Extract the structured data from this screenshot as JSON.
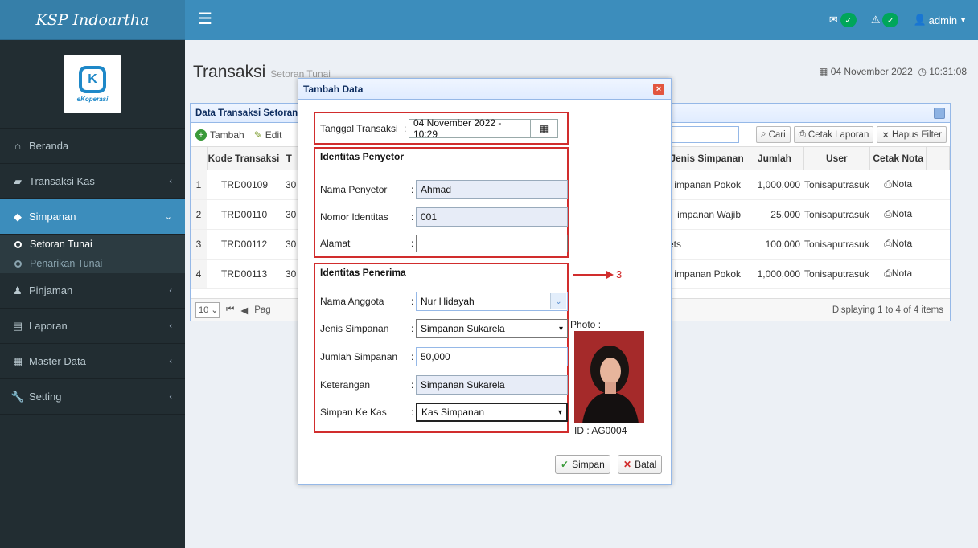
{
  "app": {
    "title": "KSP Indoartha",
    "brand_text": "eKoperasi",
    "user": "admin"
  },
  "icons": {
    "menu": "hamburger-icon",
    "mail": "envelope-icon",
    "alert": "warning-icon",
    "user": "user-icon"
  },
  "colors": {
    "primary": "#3c8dbc",
    "sidebar": "#222d32",
    "highlight": "#d12d2d",
    "success": "#00a65a"
  },
  "sidebar": {
    "items": [
      {
        "label": "Beranda"
      },
      {
        "label": "Transaksi Kas"
      },
      {
        "label": "Simpanan"
      },
      {
        "label": "Pinjaman"
      },
      {
        "label": "Laporan"
      },
      {
        "label": "Master Data"
      },
      {
        "label": "Setting"
      }
    ],
    "sub_items": [
      {
        "label": "Setoran Tunai"
      },
      {
        "label": "Penarikan Tunai"
      }
    ]
  },
  "page": {
    "title": "Transaksi",
    "subtitle": "Setoran Tunai",
    "date": "04 November 2022",
    "time": "10:31:08"
  },
  "grid": {
    "title": "Data Transaksi Setoran",
    "toolbar": {
      "add": "Tambah",
      "edit": "Edit",
      "search": "Cari",
      "print": "Cetak Laporan",
      "clear": "Hapus Filter"
    },
    "columns": {
      "kode": "Kode Transaksi",
      "tgl": "T",
      "jenis": "Jenis Simpanan",
      "jumlah": "Jumlah",
      "user": "User",
      "nota": "Cetak Nota"
    },
    "rows": [
      {
        "no": "1",
        "kode": "TRD00109",
        "tgl": "30",
        "jenis": "impanan Pokok",
        "jumlah": "1,000,000",
        "user": "Tonisaputrasuk",
        "nota": "Nota"
      },
      {
        "no": "2",
        "kode": "TRD00110",
        "tgl": "30",
        "jenis": "impanan Wajib",
        "jumlah": "25,000",
        "user": "Tonisaputrasuk",
        "nota": "Nota"
      },
      {
        "no": "3",
        "kode": "TRD00112",
        "tgl": "30",
        "jenis": "ets",
        "jumlah": "100,000",
        "user": "Tonisaputrasuk",
        "nota": "Nota"
      },
      {
        "no": "4",
        "kode": "TRD00113",
        "tgl": "30",
        "jenis": "impanan Pokok",
        "jumlah": "1,000,000",
        "user": "Tonisaputrasuk",
        "nota": "Nota"
      }
    ],
    "pager": {
      "page_size": "10",
      "page_text": "Pag",
      "display": "Displaying 1 to 4 of 4 items"
    }
  },
  "modal": {
    "title": "Tambah Data",
    "tanggal": {
      "label": "Tanggal Transaksi",
      "value": "04 November 2022 - 10:29"
    },
    "penyetor": {
      "title": "Identitas Penyetor",
      "nama_label": "Nama Penyetor",
      "nama": "Ahmad",
      "nomor_label": "Nomor Identitas",
      "nomor": "001",
      "alamat_label": "Alamat",
      "alamat": ""
    },
    "penerima": {
      "title": "Identitas Penerima",
      "anggota_label": "Nama Anggota",
      "anggota": "Nur Hidayah",
      "jenis_label": "Jenis Simpanan",
      "jenis": "Simpanan Sukarela",
      "jumlah_label": "Jumlah Simpanan",
      "jumlah": "50,000",
      "ket_label": "Keterangan",
      "ket": "Simpanan Sukarela",
      "kas_label": "Simpan Ke Kas",
      "kas": "Kas Simpanan"
    },
    "photo_label": "Photo :",
    "photo_id": "ID : AG0004",
    "annotation": "3",
    "buttons": {
      "save": "Simpan",
      "cancel": "Batal"
    }
  }
}
